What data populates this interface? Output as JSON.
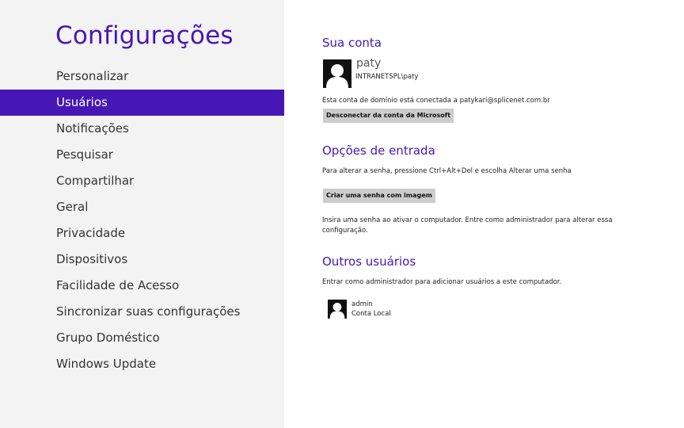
{
  "sidebar": {
    "title": "Configurações",
    "items": [
      {
        "label": "Personalizar",
        "selected": false
      },
      {
        "label": "Usuários",
        "selected": true
      },
      {
        "label": "Notificações",
        "selected": false
      },
      {
        "label": "Pesquisar",
        "selected": false
      },
      {
        "label": "Compartilhar",
        "selected": false
      },
      {
        "label": "Geral",
        "selected": false
      },
      {
        "label": "Privacidade",
        "selected": false
      },
      {
        "label": "Dispositivos",
        "selected": false
      },
      {
        "label": "Facilidade de Acesso",
        "selected": false
      },
      {
        "label": "Sincronizar suas configurações",
        "selected": false
      },
      {
        "label": "Grupo Doméstico",
        "selected": false
      },
      {
        "label": "Windows Update",
        "selected": false
      }
    ]
  },
  "account": {
    "title": "Sua conta",
    "avatar_icon": "user-silhouette-icon",
    "username": "paty",
    "domain_user": "INTRANETSPL\\paty",
    "connected_text": "Esta conta de domínio está conectada a patykari@splicenet.com.br",
    "disconnect_label": "Desconectar da conta da Microsoft"
  },
  "signin": {
    "title": "Opções de entrada",
    "password_hint": "Para alterar a senha, pressione Ctrl+Alt+Del e escolha Alterar uma senha",
    "picture_password_label": "Criar uma senha com imagem",
    "info_line1": "Insira uma senha ao ativar o computador. Entre como administrador para alterar essa",
    "info_line2": "configuração."
  },
  "others": {
    "title": "Outros usuários",
    "hint": "Entrar como administrador para adicionar usuários a este computador.",
    "users": [
      {
        "name": "admin",
        "type": "Conta Local"
      }
    ]
  },
  "colors": {
    "accent": "#4617b4",
    "sidebar_bg": "#f3f3f3",
    "button_bg": "#cccccc"
  }
}
